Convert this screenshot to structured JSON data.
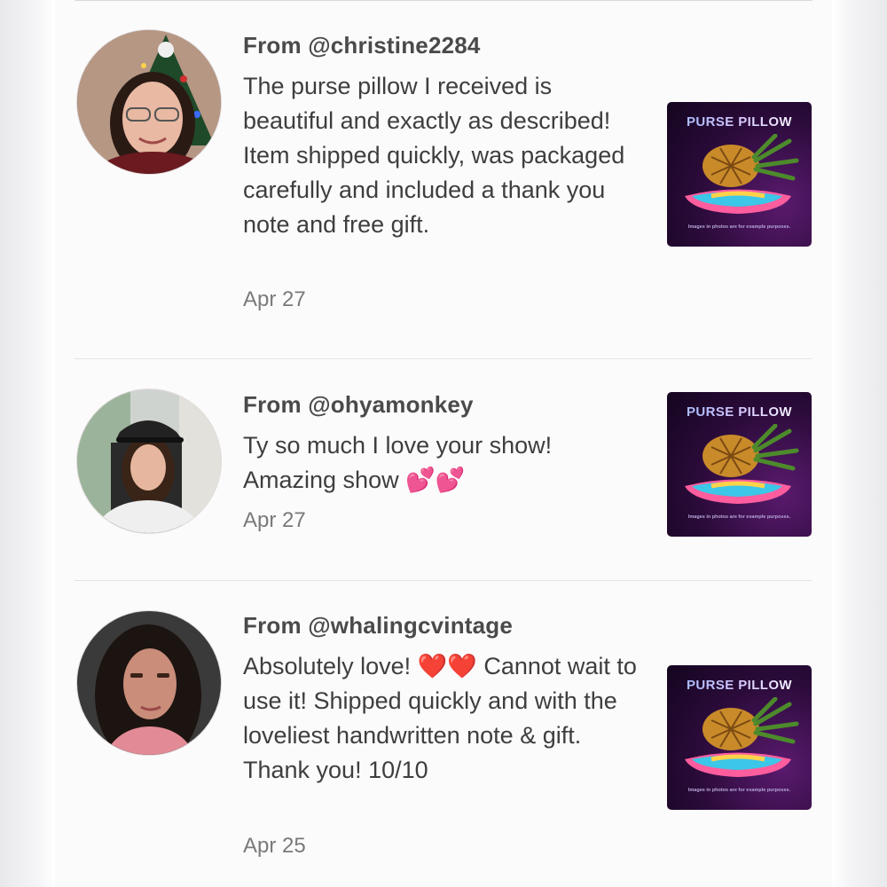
{
  "reviews": [
    {
      "from": "From @christine2284",
      "text": "The purse pillow I received is beautiful and exactly as described! Item shipped quickly, was packaged carefully and included a thank you note and free gift.",
      "date": "Apr 27",
      "product_title": "PURSE PILLOW",
      "product_note": "Images in photos are for example purposes."
    },
    {
      "from": "From @ohyamonkey",
      "text": "Ty so much I love your show! Amazing show 💕💕",
      "date": "Apr 27",
      "product_title": "PURSE PILLOW",
      "product_note": "Images in photos are for example purposes."
    },
    {
      "from": "From @whalingcvintage",
      "text": "Absolutely love! ❤️❤️ Cannot wait to use it! Shipped quickly and with the loveliest handwritten note & gift. Thank you! 10/10",
      "date": "Apr 25",
      "product_title": "PURSE PILLOW",
      "product_note": "Images in photos are for example purposes."
    }
  ],
  "colors": {
    "heart_pink": "#e8338f",
    "heart_red": "#e0201f",
    "thumb_bg": "#2b0b3a"
  },
  "icons": [
    "two-hearts-emoji",
    "red-heart-emoji",
    "pineapple-on-pillow-image"
  ]
}
